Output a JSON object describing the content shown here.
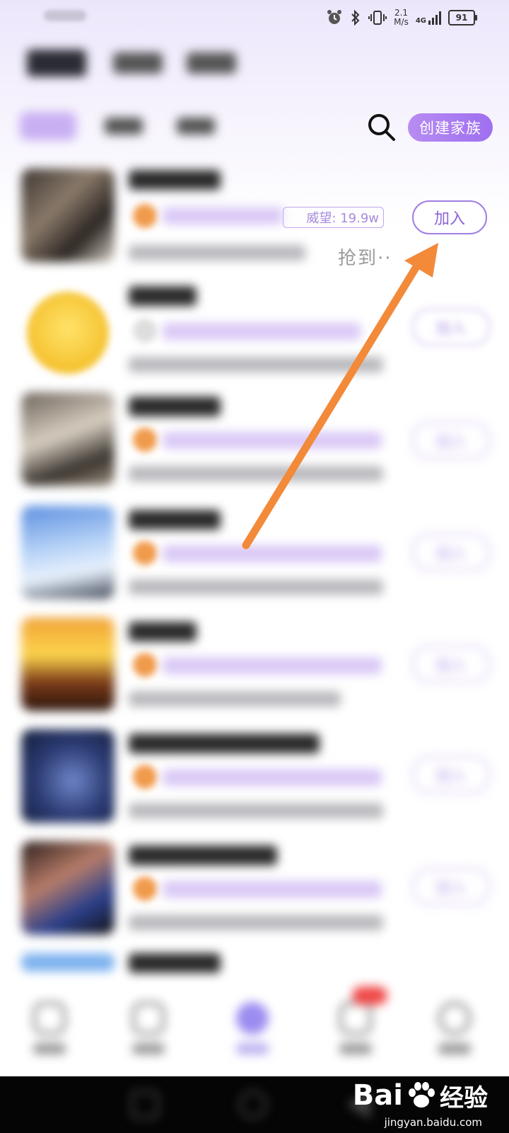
{
  "status_bar": {
    "speed_value": "2.1",
    "speed_unit": "M/s",
    "network": "4G",
    "battery": "91"
  },
  "header": {
    "create_family_label": "创建家族"
  },
  "list": {
    "row1": {
      "prestige_label": "威望: 19.9w",
      "tail_text": "抢到··",
      "join_label": "加入"
    },
    "join_label": "加入"
  },
  "watermark": {
    "brand_left": "Bai",
    "brand_right": "经验",
    "url": "jingyan.baidu.com"
  },
  "colors": {
    "accent": "#a07fe0",
    "create_button": "#a874f0",
    "arrow": "#f28a3a"
  }
}
